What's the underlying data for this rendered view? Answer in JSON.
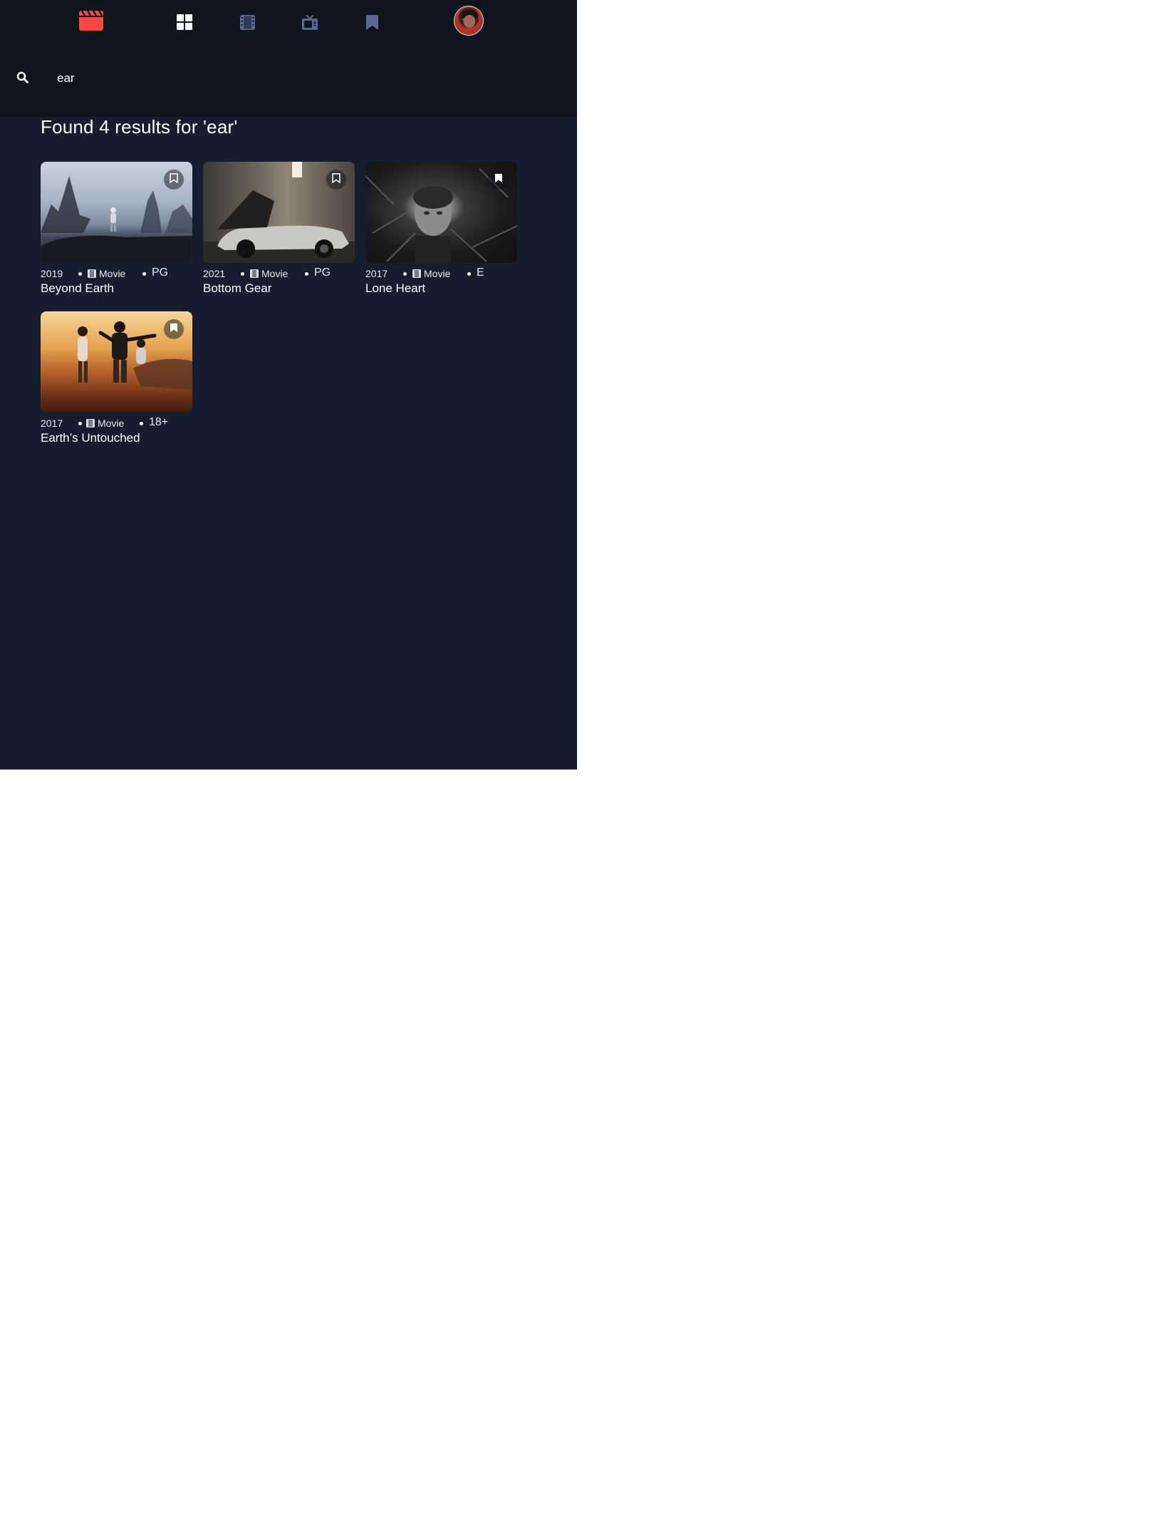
{
  "nav": {
    "logo_icon": "clapperboard-icon",
    "items": [
      {
        "name": "home",
        "icon": "grid-icon",
        "active": true
      },
      {
        "name": "movies",
        "icon": "film-icon",
        "active": false
      },
      {
        "name": "tv-series",
        "icon": "tv-icon",
        "active": false
      },
      {
        "name": "bookmarks",
        "icon": "bookmark-icon",
        "active": false
      }
    ]
  },
  "search": {
    "value": "ear",
    "icon": "search-icon"
  },
  "results": {
    "heading": "Found 4 results for 'ear'",
    "items": [
      {
        "year": "2019",
        "category": "Movie",
        "rating": "PG",
        "title": "Beyond Earth",
        "bookmarked": false
      },
      {
        "year": "2021",
        "category": "Movie",
        "rating": "PG",
        "title": "Bottom Gear",
        "bookmarked": false
      },
      {
        "year": "2017",
        "category": "Movie",
        "rating": "E",
        "title": "Lone Heart",
        "bookmarked": true
      },
      {
        "year": "2017",
        "category": "Movie",
        "rating": "18+",
        "title": "Earth’s Untouched",
        "bookmarked": true
      }
    ]
  },
  "colors": {
    "background": "#161d2f",
    "nav_background": "#10141e",
    "accent": "#fc4747",
    "inactive_icon": "#5a698f",
    "text": "#ffffff"
  }
}
